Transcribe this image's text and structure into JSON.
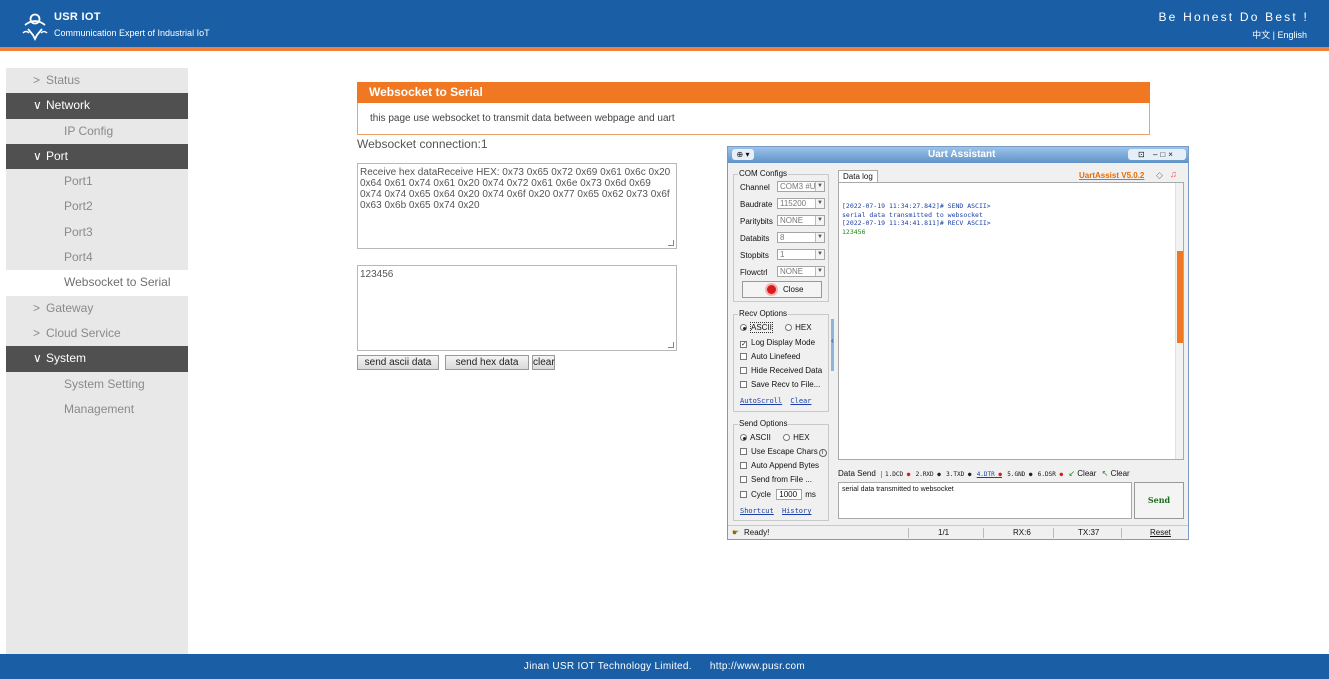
{
  "header": {
    "brand": "USR IOT",
    "tagline": "Communication Expert of Industrial IoT",
    "motto": "Be Honest Do Best !",
    "lang_cn": "中文",
    "lang_sep": " | ",
    "lang_en": "English"
  },
  "sidebar": {
    "items": [
      {
        "label": "Status",
        "level": 1,
        "chevron": ">",
        "state": "collapsed"
      },
      {
        "label": "Network",
        "level": 1,
        "chevron": "∨",
        "state": "open"
      },
      {
        "label": "IP Config",
        "level": 2
      },
      {
        "label": "Port",
        "level": 1,
        "chevron": "∨",
        "state": "open"
      },
      {
        "label": "Port1",
        "level": 2
      },
      {
        "label": "Port2",
        "level": 2
      },
      {
        "label": "Port3",
        "level": 2
      },
      {
        "label": "Port4",
        "level": 2
      },
      {
        "label": "Websocket to Serial",
        "level": 2,
        "state": "active"
      },
      {
        "label": "Gateway",
        "level": 1,
        "chevron": ">",
        "state": "collapsed"
      },
      {
        "label": "Cloud Service",
        "level": 1,
        "chevron": ">",
        "state": "collapsed"
      },
      {
        "label": "System",
        "level": 1,
        "chevron": "∨",
        "state": "open"
      },
      {
        "label": "System Setting",
        "level": 2
      },
      {
        "label": "Management",
        "level": 2
      }
    ]
  },
  "main": {
    "panel_title": "Websocket to Serial",
    "panel_desc": "this page use websocket to transmit data between webpage and uart",
    "connection_status": "Websocket connection:1",
    "receive_text": "Receive hex dataReceive HEX: 0x73 0x65 0x72 0x69 0x61 0x6c 0x20 0x64 0x61 0x74 0x61 0x20 0x74 0x72 0x61 0x6e 0x73 0x6d 0x69 0x74 0x74 0x65 0x64 0x20 0x74 0x6f 0x20 0x77 0x65 0x62 0x73 0x6f 0x63 0x6b 0x65 0x74 0x20",
    "send_text": "123456",
    "btn_send_ascii": "send ascii data",
    "btn_send_hex": "send hex data",
    "btn_clear": "clear"
  },
  "uart": {
    "title": "Uart Assistant",
    "version_link": "UartAssist V5.0.2",
    "com_configs_label": "COM Configs",
    "channel_label": "Channel",
    "channel_value": "COM3 #US",
    "baudrate_label": "Baudrate",
    "baudrate_value": "115200",
    "paritybits_label": "Paritybits",
    "paritybits_value": "NONE",
    "databits_label": "Databits",
    "databits_value": "8",
    "stopbits_label": "Stopbits",
    "stopbits_value": "1",
    "flowctrl_label": "Flowctrl",
    "flowctrl_value": "NONE",
    "close_label": "Close",
    "recv_options_label": "Recv Options",
    "recv_ascii": "ASCII",
    "recv_hex": "HEX",
    "log_display_mode": "Log Display Mode",
    "auto_linefeed": "Auto Linefeed",
    "hide_received_data": "Hide Received Data",
    "save_recv_to_file": "Save Recv to File...",
    "autoscroll": "AutoScroll",
    "clear_link": "Clear",
    "send_options_label": "Send Options",
    "send_ascii": "ASCII",
    "send_hex": "HEX",
    "use_escape_chars": "Use Escape Chars",
    "auto_append_bytes": "Auto Append Bytes",
    "send_from_file": "Send from File ...",
    "cycle_label": "Cycle",
    "cycle_value": "1000",
    "cycle_unit": "ms",
    "shortcut_link": "Shortcut",
    "history_link": "History",
    "data_log_tab": "Data log",
    "log_line1": "[2022-07-19 11:34:27.842]# SEND ASCII>",
    "log_line2": "serial data transmitted to websocket",
    "log_line3": "[2022-07-19 11:34:41.811]# RECV ASCII>",
    "log_line4": "123456",
    "data_send_label": "Data Send",
    "pin_dcd": "1.DCD",
    "pin_rxd": "2.RXD",
    "pin_txd": "3.TXD",
    "pin_dtr": "4.DTR",
    "pin_gnd": "5.GND",
    "pin_dsr": "6.DSR",
    "clear_btn1": "Clear",
    "clear_btn2": "Clear",
    "send_box_text": "serial data transmitted to websocket",
    "send_button": "Send",
    "status_ready": "Ready!",
    "status_page": "1/1",
    "status_rx": "RX:6",
    "status_tx": "TX:37",
    "status_reset": "Reset",
    "colors": {
      "log_send": "#1a3fa6",
      "log_recv": "#1a8a1a",
      "led_red": "#d81b1b"
    }
  },
  "footer": {
    "company": "Jinan USR IOT Technology Limited.",
    "url": "http://www.pusr.com"
  },
  "colors": {
    "header_blue": "#1a5ea6",
    "accent_orange": "#f07822",
    "sidebar_bg": "#e8e8e8",
    "sidebar_open": "#505050"
  }
}
